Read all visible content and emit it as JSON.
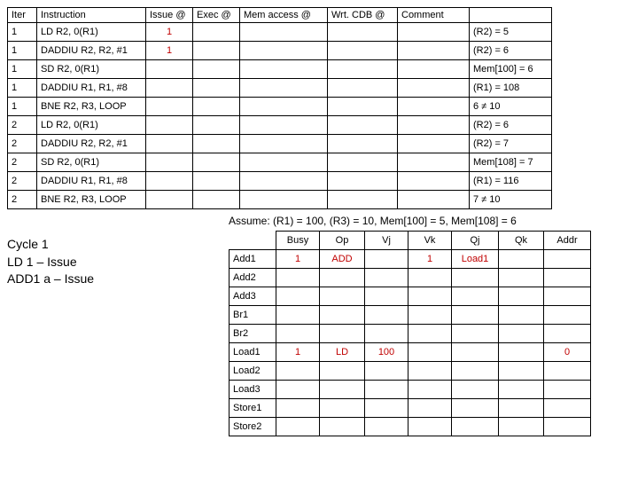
{
  "instr_table": {
    "headers": [
      "Iter",
      "Instruction",
      "Issue @",
      "Exec @",
      "Mem access @",
      "Wrt. CDB @",
      "Comment",
      ""
    ],
    "rows": [
      {
        "iter": "1",
        "instr": "LD R2, 0(R1)",
        "issue": "1",
        "exec": "",
        "mem": "",
        "cdb": "",
        "comm": "",
        "res": "(R2) = 5",
        "red": true
      },
      {
        "iter": "1",
        "instr": "DADDIU R2, R2, #1",
        "issue": "1",
        "exec": "",
        "mem": "",
        "cdb": "",
        "comm": "",
        "res": "(R2) = 6",
        "red": true
      },
      {
        "iter": "1",
        "instr": "SD R2, 0(R1)",
        "issue": "",
        "exec": "",
        "mem": "",
        "cdb": "",
        "comm": "",
        "res": "Mem[100] = 6",
        "red": false
      },
      {
        "iter": "1",
        "instr": "DADDIU R1, R1, #8",
        "issue": "",
        "exec": "",
        "mem": "",
        "cdb": "",
        "comm": "",
        "res": "(R1) = 108",
        "red": false
      },
      {
        "iter": "1",
        "instr": "BNE R2, R3, LOOP",
        "issue": "",
        "exec": "",
        "mem": "",
        "cdb": "",
        "comm": "",
        "res": "6 ≠ 10",
        "red": false
      },
      {
        "iter": "2",
        "instr": "LD R2, 0(R1)",
        "issue": "",
        "exec": "",
        "mem": "",
        "cdb": "",
        "comm": "",
        "res": "(R2) = 6",
        "red": false
      },
      {
        "iter": "2",
        "instr": "DADDIU R2, R2, #1",
        "issue": "",
        "exec": "",
        "mem": "",
        "cdb": "",
        "comm": "",
        "res": "(R2) = 7",
        "red": false
      },
      {
        "iter": "2",
        "instr": "SD R2, 0(R1)",
        "issue": "",
        "exec": "",
        "mem": "",
        "cdb": "",
        "comm": "",
        "res": "Mem[108] = 7",
        "red": false
      },
      {
        "iter": "2",
        "instr": "DADDIU R1, R1, #8",
        "issue": "",
        "exec": "",
        "mem": "",
        "cdb": "",
        "comm": "",
        "res": "(R1) = 116",
        "red": false
      },
      {
        "iter": "2",
        "instr": "BNE R2, R3, LOOP",
        "issue": "",
        "exec": "",
        "mem": "",
        "cdb": "",
        "comm": "",
        "res": "7 ≠ 10",
        "red": false
      }
    ]
  },
  "assume": "Assume: (R1) = 100, (R3) = 10, Mem[100] = 5, Mem[108] = 6",
  "cycle": {
    "title": "Cycle 1",
    "line1": "LD 1 – Issue",
    "line2": "ADD1 a – Issue"
  },
  "rs_table": {
    "headers": [
      "",
      "Busy",
      "Op",
      "Vj",
      "Vk",
      "Qj",
      "Qk",
      "Addr"
    ],
    "rows": [
      {
        "name": "Add1",
        "busy": "1",
        "op": "ADD",
        "vj": "",
        "vk": "1",
        "qj": "Load1",
        "qk": "",
        "addr": "",
        "red": true
      },
      {
        "name": "Add2",
        "busy": "",
        "op": "",
        "vj": "",
        "vk": "",
        "qj": "",
        "qk": "",
        "addr": "",
        "red": false
      },
      {
        "name": "Add3",
        "busy": "",
        "op": "",
        "vj": "",
        "vk": "",
        "qj": "",
        "qk": "",
        "addr": "",
        "red": false
      },
      {
        "name": "Br1",
        "busy": "",
        "op": "",
        "vj": "",
        "vk": "",
        "qj": "",
        "qk": "",
        "addr": "",
        "red": false
      },
      {
        "name": "Br2",
        "busy": "",
        "op": "",
        "vj": "",
        "vk": "",
        "qj": "",
        "qk": "",
        "addr": "",
        "red": false
      },
      {
        "name": "Load1",
        "busy": "1",
        "op": "LD",
        "vj": "100",
        "vk": "",
        "qj": "",
        "qk": "",
        "addr": "0",
        "red": true
      },
      {
        "name": "Load2",
        "busy": "",
        "op": "",
        "vj": "",
        "vk": "",
        "qj": "",
        "qk": "",
        "addr": "",
        "red": false
      },
      {
        "name": "Load3",
        "busy": "",
        "op": "",
        "vj": "",
        "vk": "",
        "qj": "",
        "qk": "",
        "addr": "",
        "red": false
      },
      {
        "name": "Store1",
        "busy": "",
        "op": "",
        "vj": "",
        "vk": "",
        "qj": "",
        "qk": "",
        "addr": "",
        "red": false
      },
      {
        "name": "Store2",
        "busy": "",
        "op": "",
        "vj": "",
        "vk": "",
        "qj": "",
        "qk": "",
        "addr": "",
        "red": false
      }
    ]
  }
}
